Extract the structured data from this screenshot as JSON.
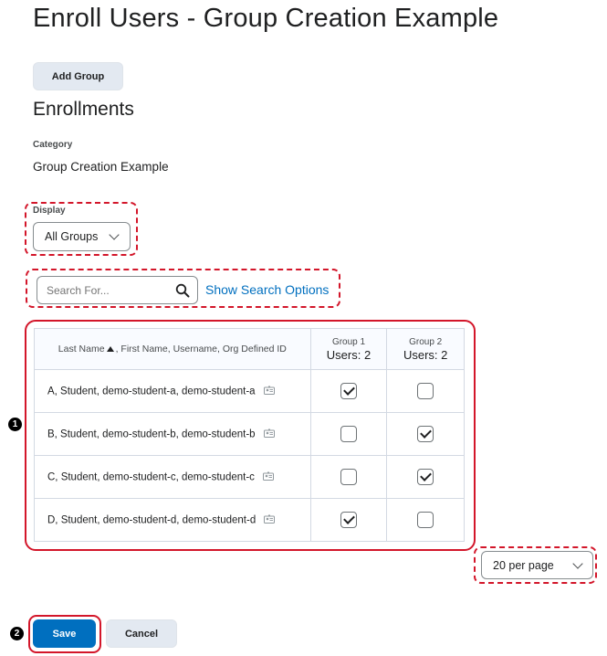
{
  "page": {
    "title": "Enroll Users - Group Creation Example"
  },
  "toolbar": {
    "add_group_label": "Add Group"
  },
  "enrollments": {
    "heading": "Enrollments",
    "category_label": "Category",
    "category_value": "Group Creation Example"
  },
  "display": {
    "label": "Display",
    "selected": "All Groups"
  },
  "search": {
    "placeholder": "Search For...",
    "options_link": "Show Search Options"
  },
  "table": {
    "name_header_part1": "Last Name",
    "name_header_part2": ", First Name, Username, Org Defined ID",
    "groups": [
      {
        "name": "Group 1",
        "users": "Users: 2"
      },
      {
        "name": "Group 2",
        "users": "Users: 2"
      }
    ],
    "rows": [
      {
        "name": "A, Student, demo-student-a, demo-student-a",
        "group1": true,
        "group2": false
      },
      {
        "name": "B, Student, demo-student-b, demo-student-b",
        "group1": false,
        "group2": true
      },
      {
        "name": "C, Student, demo-student-c, demo-student-c",
        "group1": false,
        "group2": true
      },
      {
        "name": "D, Student, demo-student-d, demo-student-d",
        "group1": true,
        "group2": false
      }
    ]
  },
  "pagination": {
    "per_page": "20 per page"
  },
  "footer": {
    "save_label": "Save",
    "cancel_label": "Cancel"
  },
  "callouts": {
    "badge1": "1",
    "badge2": "2"
  },
  "colors": {
    "accent": "#006fbf",
    "callout": "#d3162a",
    "secondary_button": "#e3e9f1"
  },
  "icons": {
    "search": "magnifier-icon",
    "dropdown": "chevron-down-icon",
    "sort": "sort-ascending-icon",
    "user": "user-card-icon"
  }
}
